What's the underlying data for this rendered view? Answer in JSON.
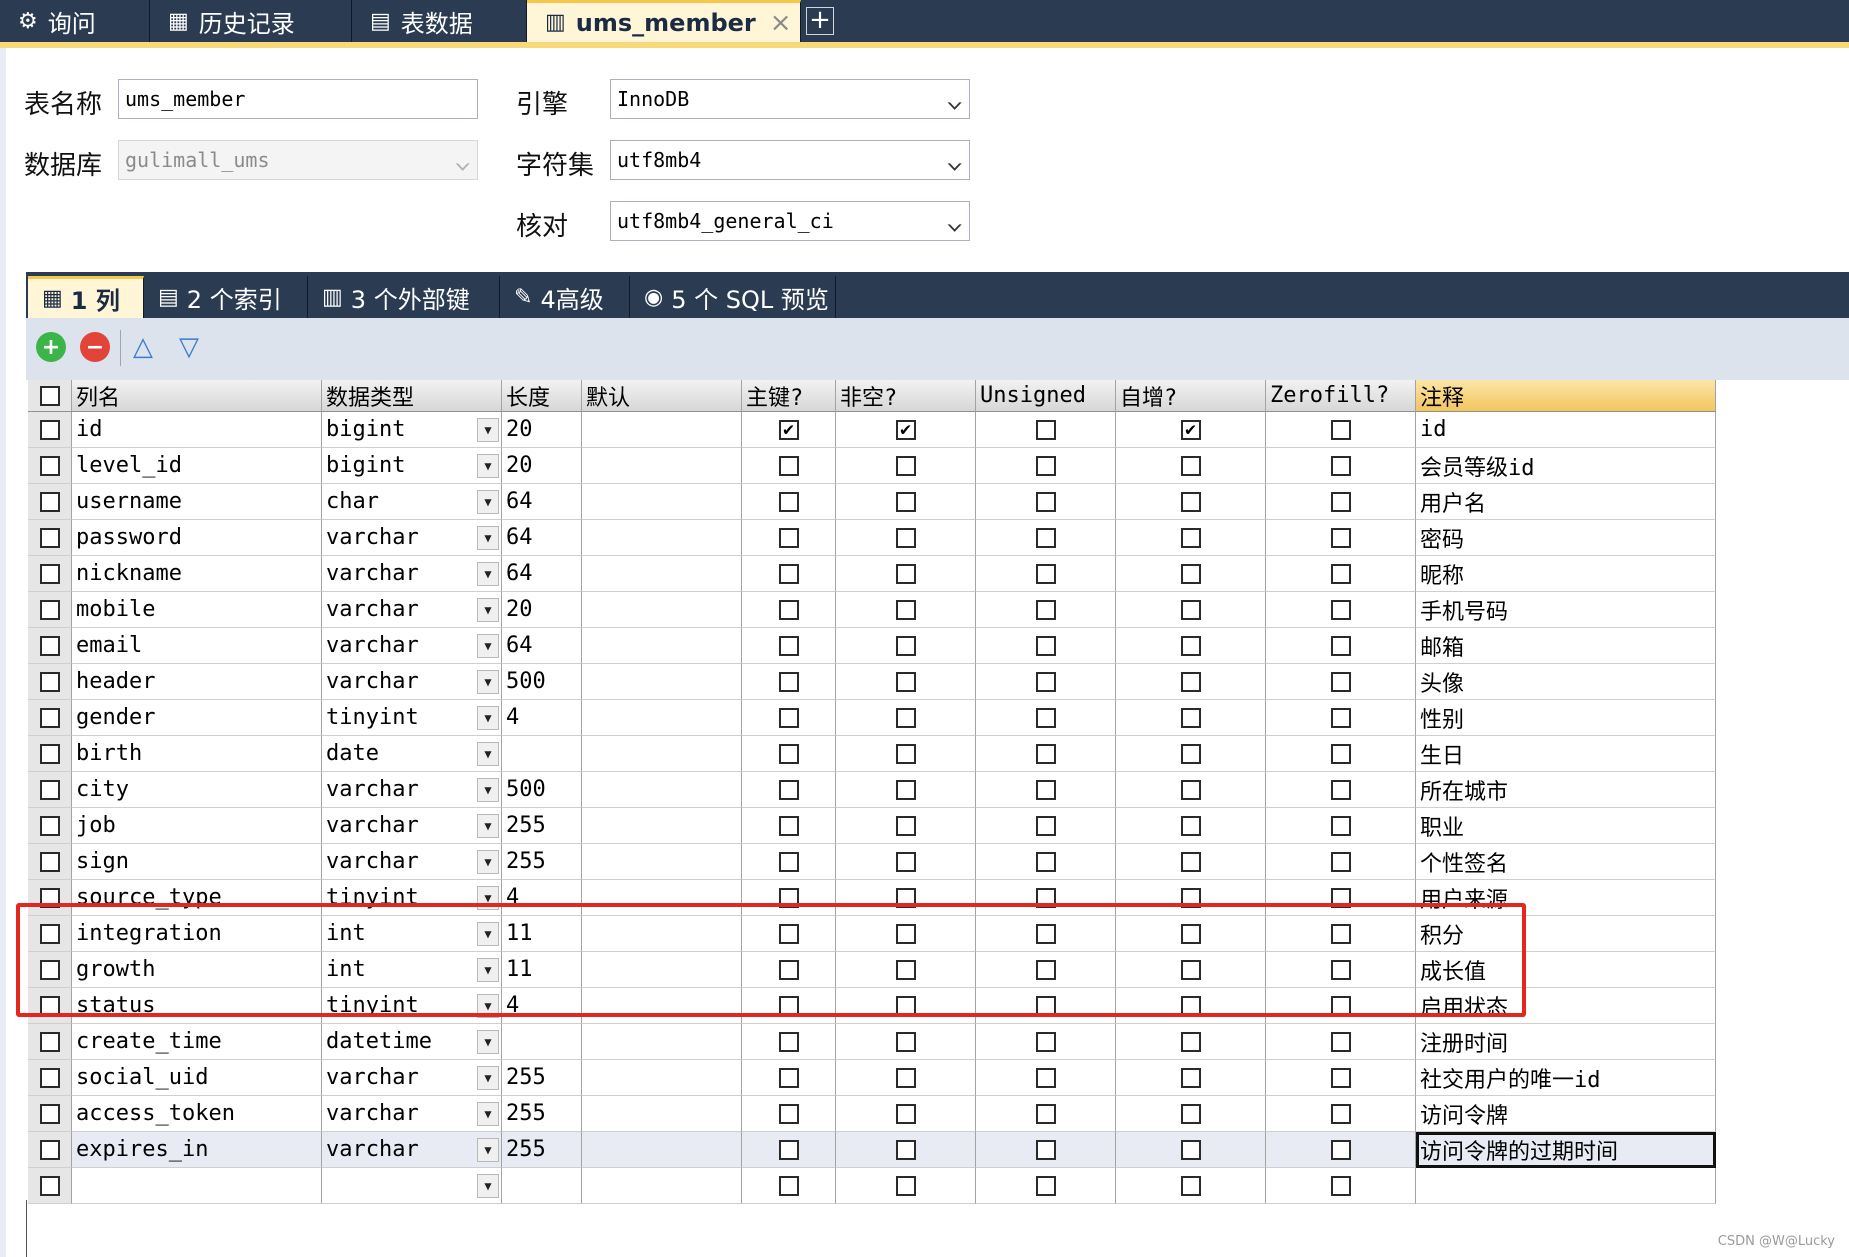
{
  "top_tabs": [
    {
      "label": "询问",
      "icon": "query-icon"
    },
    {
      "label": "历史记录",
      "icon": "calendar-icon"
    },
    {
      "label": "表数据",
      "icon": "table-icon"
    },
    {
      "label": "ums_member",
      "icon": "table-design-icon",
      "active": true
    }
  ],
  "form": {
    "table_name_label": "表名称",
    "table_name": "ums_member",
    "database_label": "数据库",
    "database": "gulimall_ums",
    "engine_label": "引擎",
    "engine": "InnoDB",
    "charset_label": "字符集",
    "charset": "utf8mb4",
    "collation_label": "核对",
    "collation": "utf8mb4_general_ci"
  },
  "section_tabs": [
    {
      "label": "1 列",
      "icon": "columns-icon",
      "active": true
    },
    {
      "label": "2 个索引",
      "icon": "index-icon"
    },
    {
      "label": "3 个外部键",
      "icon": "foreign-key-icon"
    },
    {
      "label": "4高级",
      "icon": "advanced-icon"
    },
    {
      "label": "5 个 SQL 预览",
      "icon": "sql-preview-icon"
    }
  ],
  "grid": {
    "headers": [
      "列名",
      "数据类型",
      "长度",
      "默认",
      "主键?",
      "非空?",
      "Unsigned",
      "自增?",
      "Zerofill?",
      "注释"
    ],
    "rows": [
      {
        "name": "id",
        "type": "bigint",
        "len": "20",
        "default": "",
        "pk": true,
        "nn": true,
        "unsigned": false,
        "ai": true,
        "zf": false,
        "comment": "id"
      },
      {
        "name": "level_id",
        "type": "bigint",
        "len": "20",
        "default": "",
        "pk": false,
        "nn": false,
        "unsigned": false,
        "ai": false,
        "zf": false,
        "comment": "会员等级id"
      },
      {
        "name": "username",
        "type": "char",
        "len": "64",
        "default": "",
        "pk": false,
        "nn": false,
        "unsigned": false,
        "ai": false,
        "zf": false,
        "comment": "用户名"
      },
      {
        "name": "password",
        "type": "varchar",
        "len": "64",
        "default": "",
        "pk": false,
        "nn": false,
        "unsigned": false,
        "ai": false,
        "zf": false,
        "comment": "密码"
      },
      {
        "name": "nickname",
        "type": "varchar",
        "len": "64",
        "default": "",
        "pk": false,
        "nn": false,
        "unsigned": false,
        "ai": false,
        "zf": false,
        "comment": "昵称"
      },
      {
        "name": "mobile",
        "type": "varchar",
        "len": "20",
        "default": "",
        "pk": false,
        "nn": false,
        "unsigned": false,
        "ai": false,
        "zf": false,
        "comment": "手机号码"
      },
      {
        "name": "email",
        "type": "varchar",
        "len": "64",
        "default": "",
        "pk": false,
        "nn": false,
        "unsigned": false,
        "ai": false,
        "zf": false,
        "comment": "邮箱"
      },
      {
        "name": "header",
        "type": "varchar",
        "len": "500",
        "default": "",
        "pk": false,
        "nn": false,
        "unsigned": false,
        "ai": false,
        "zf": false,
        "comment": "头像"
      },
      {
        "name": "gender",
        "type": "tinyint",
        "len": "4",
        "default": "",
        "pk": false,
        "nn": false,
        "unsigned": false,
        "ai": false,
        "zf": false,
        "comment": "性别"
      },
      {
        "name": "birth",
        "type": "date",
        "len": "",
        "default": "",
        "pk": false,
        "nn": false,
        "unsigned": false,
        "ai": false,
        "zf": false,
        "comment": "生日"
      },
      {
        "name": "city",
        "type": "varchar",
        "len": "500",
        "default": "",
        "pk": false,
        "nn": false,
        "unsigned": false,
        "ai": false,
        "zf": false,
        "comment": "所在城市"
      },
      {
        "name": "job",
        "type": "varchar",
        "len": "255",
        "default": "",
        "pk": false,
        "nn": false,
        "unsigned": false,
        "ai": false,
        "zf": false,
        "comment": "职业"
      },
      {
        "name": "sign",
        "type": "varchar",
        "len": "255",
        "default": "",
        "pk": false,
        "nn": false,
        "unsigned": false,
        "ai": false,
        "zf": false,
        "comment": "个性签名"
      },
      {
        "name": "source_type",
        "type": "tinyint",
        "len": "4",
        "default": "",
        "pk": false,
        "nn": false,
        "unsigned": false,
        "ai": false,
        "zf": false,
        "comment": "用户来源"
      },
      {
        "name": "integration",
        "type": "int",
        "len": "11",
        "default": "",
        "pk": false,
        "nn": false,
        "unsigned": false,
        "ai": false,
        "zf": false,
        "comment": "积分"
      },
      {
        "name": "growth",
        "type": "int",
        "len": "11",
        "default": "",
        "pk": false,
        "nn": false,
        "unsigned": false,
        "ai": false,
        "zf": false,
        "comment": "成长值"
      },
      {
        "name": "status",
        "type": "tinyint",
        "len": "4",
        "default": "",
        "pk": false,
        "nn": false,
        "unsigned": false,
        "ai": false,
        "zf": false,
        "comment": "启用状态"
      },
      {
        "name": "create_time",
        "type": "datetime",
        "len": "",
        "default": "",
        "pk": false,
        "nn": false,
        "unsigned": false,
        "ai": false,
        "zf": false,
        "comment": "注册时间"
      },
      {
        "name": "social_uid",
        "type": "varchar",
        "len": "255",
        "default": "",
        "pk": false,
        "nn": false,
        "unsigned": false,
        "ai": false,
        "zf": false,
        "comment": "社交用户的唯一id"
      },
      {
        "name": "access_token",
        "type": "varchar",
        "len": "255",
        "default": "",
        "pk": false,
        "nn": false,
        "unsigned": false,
        "ai": false,
        "zf": false,
        "comment": "访问令牌"
      },
      {
        "name": "expires_in",
        "type": "varchar",
        "len": "255",
        "default": "",
        "pk": false,
        "nn": false,
        "unsigned": false,
        "ai": false,
        "zf": false,
        "comment": "访问令牌的过期时间",
        "highlighted": true
      },
      {
        "name": "",
        "type": "",
        "len": "",
        "default": "",
        "pk": false,
        "nn": false,
        "unsigned": false,
        "ai": false,
        "zf": false,
        "comment": ""
      }
    ]
  },
  "colors": {
    "accent": "#f6c74a",
    "tabbar": "#2b3b52",
    "highlight_box": "#e3261e"
  },
  "watermark": "CSDN @W@Lucky"
}
